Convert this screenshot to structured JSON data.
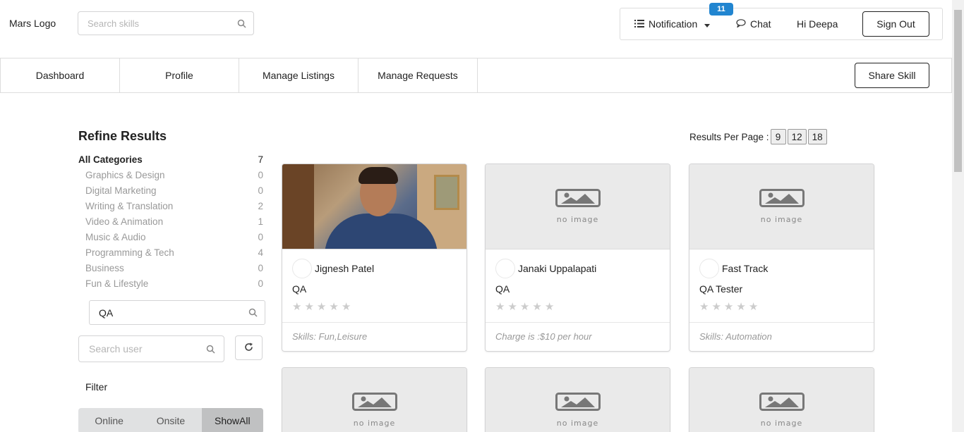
{
  "header": {
    "logo": "Mars Logo",
    "search_placeholder": "Search skills",
    "notification_label": "Notification",
    "notification_count": "11",
    "chat_label": "Chat",
    "greeting": "Hi Deepa",
    "signout_label": "Sign Out"
  },
  "nav": {
    "tabs": [
      {
        "label": "Dashboard"
      },
      {
        "label": "Profile"
      },
      {
        "label": "Manage Listings"
      },
      {
        "label": "Manage Requests"
      }
    ],
    "share_label": "Share Skill"
  },
  "sidebar": {
    "title": "Refine Results",
    "categories": [
      {
        "name": "All Categories",
        "count": "7"
      },
      {
        "name": "Graphics & Design",
        "count": "0"
      },
      {
        "name": "Digital Marketing",
        "count": "0"
      },
      {
        "name": "Writing & Translation",
        "count": "2"
      },
      {
        "name": "Video & Animation",
        "count": "1"
      },
      {
        "name": "Music & Audio",
        "count": "0"
      },
      {
        "name": "Programming & Tech",
        "count": "4"
      },
      {
        "name": "Business",
        "count": "0"
      },
      {
        "name": "Fun & Lifestyle",
        "count": "0"
      }
    ],
    "skill_search_value": "QA",
    "user_search_placeholder": "Search user",
    "filter_label": "Filter",
    "filter_options": [
      "Online",
      "Onsite",
      "ShowAll"
    ],
    "filter_selected": "ShowAll"
  },
  "results": {
    "per_page_label": "Results Per Page :",
    "per_page_options": [
      "9",
      "12",
      "18"
    ],
    "no_image_label": "no image",
    "cards": [
      {
        "owner": "Jignesh Patel",
        "title": "QA",
        "rating": 0,
        "extra": "Skills: Fun,Leisure",
        "has_photo": true
      },
      {
        "owner": "Janaki Uppalapati",
        "title": "QA",
        "rating": 0,
        "extra": "Charge is :$10 per hour",
        "has_photo": false
      },
      {
        "owner": "Fast Track",
        "title": "QA Tester",
        "rating": 0,
        "extra": "Skills: Automation",
        "has_photo": false
      }
    ]
  },
  "colors": {
    "badge": "#2185d0",
    "muted_text": "#999999",
    "filter_active": "#c0c1c2"
  }
}
